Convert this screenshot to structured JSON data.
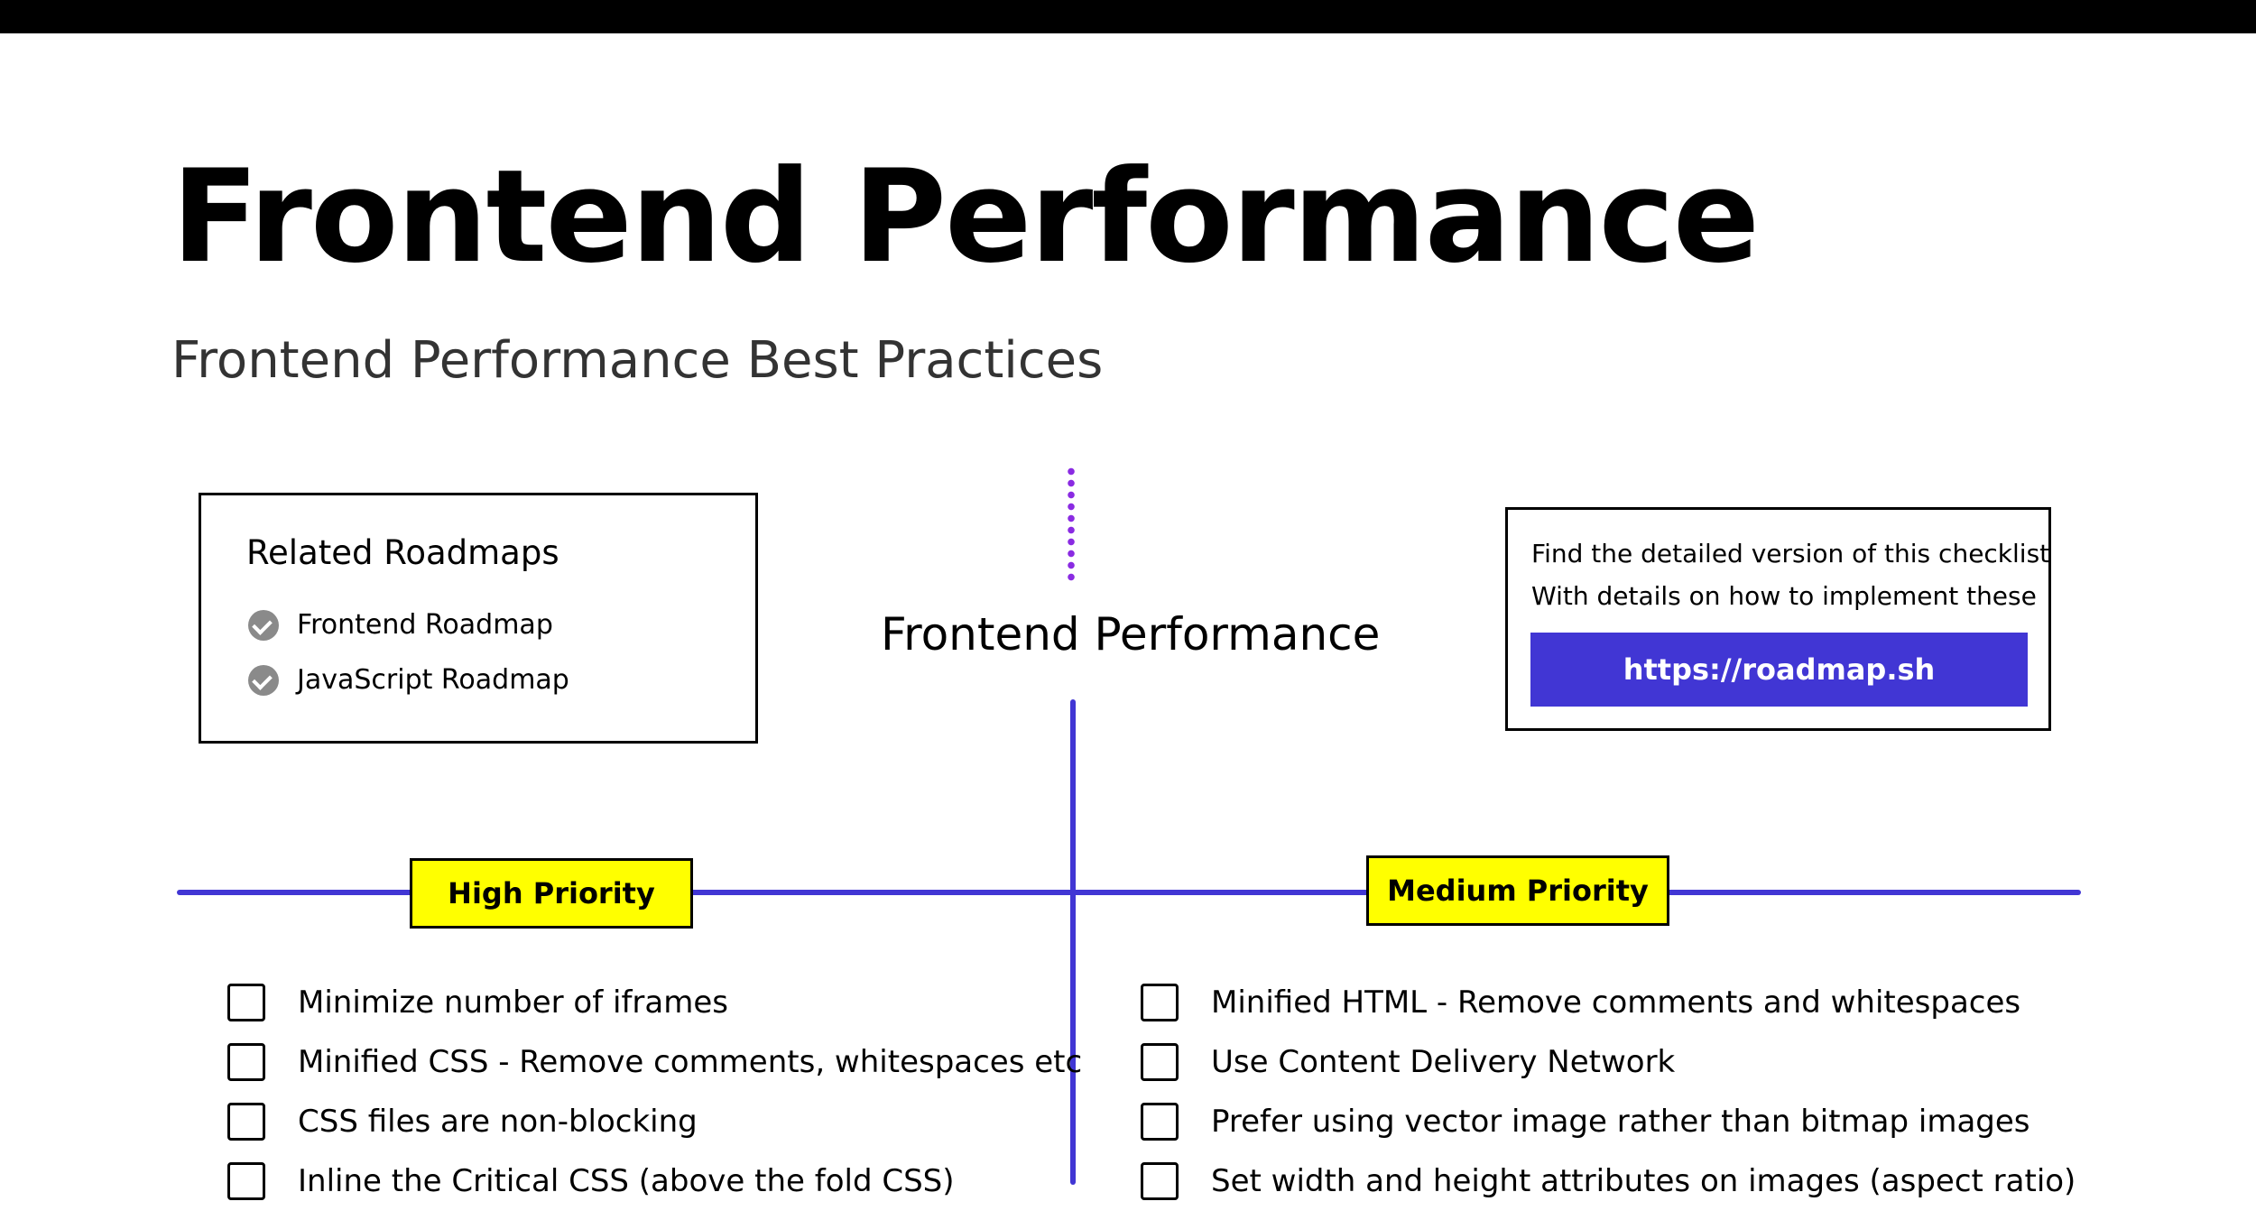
{
  "page": {
    "title": "Frontend Performance",
    "subtitle": "Frontend Performance Best Practices"
  },
  "related": {
    "title": "Related Roadmaps",
    "items": [
      {
        "label": "Frontend Roadmap",
        "icon": "check-circle-icon"
      },
      {
        "label": "JavaScript Roadmap",
        "icon": "check-circle-icon"
      }
    ]
  },
  "center": {
    "title": "Frontend Performance"
  },
  "detail": {
    "line1": "Find the detailed version of this checklist",
    "line2": "With details on how to implement these",
    "link_label": "https://roadmap.sh"
  },
  "sections": {
    "high": {
      "label": "High Priority",
      "items": [
        "Minimize number of iframes",
        "Minified CSS - Remove comments, whitespaces etc",
        "CSS files are non-blocking",
        "Inline the Critical CSS (above the fold CSS)"
      ]
    },
    "medium": {
      "label": "Medium Priority",
      "items": [
        "Minified HTML - Remove comments and whitespaces",
        "Use Content Delivery Network",
        "Prefer using vector image rather than bitmap images",
        "Set width and height attributes on images (aspect ratio)"
      ]
    }
  },
  "colors": {
    "accent": "#4136d4",
    "highlight": "#ffff00",
    "dots": "#8a2be2",
    "topbar": "#000000"
  }
}
